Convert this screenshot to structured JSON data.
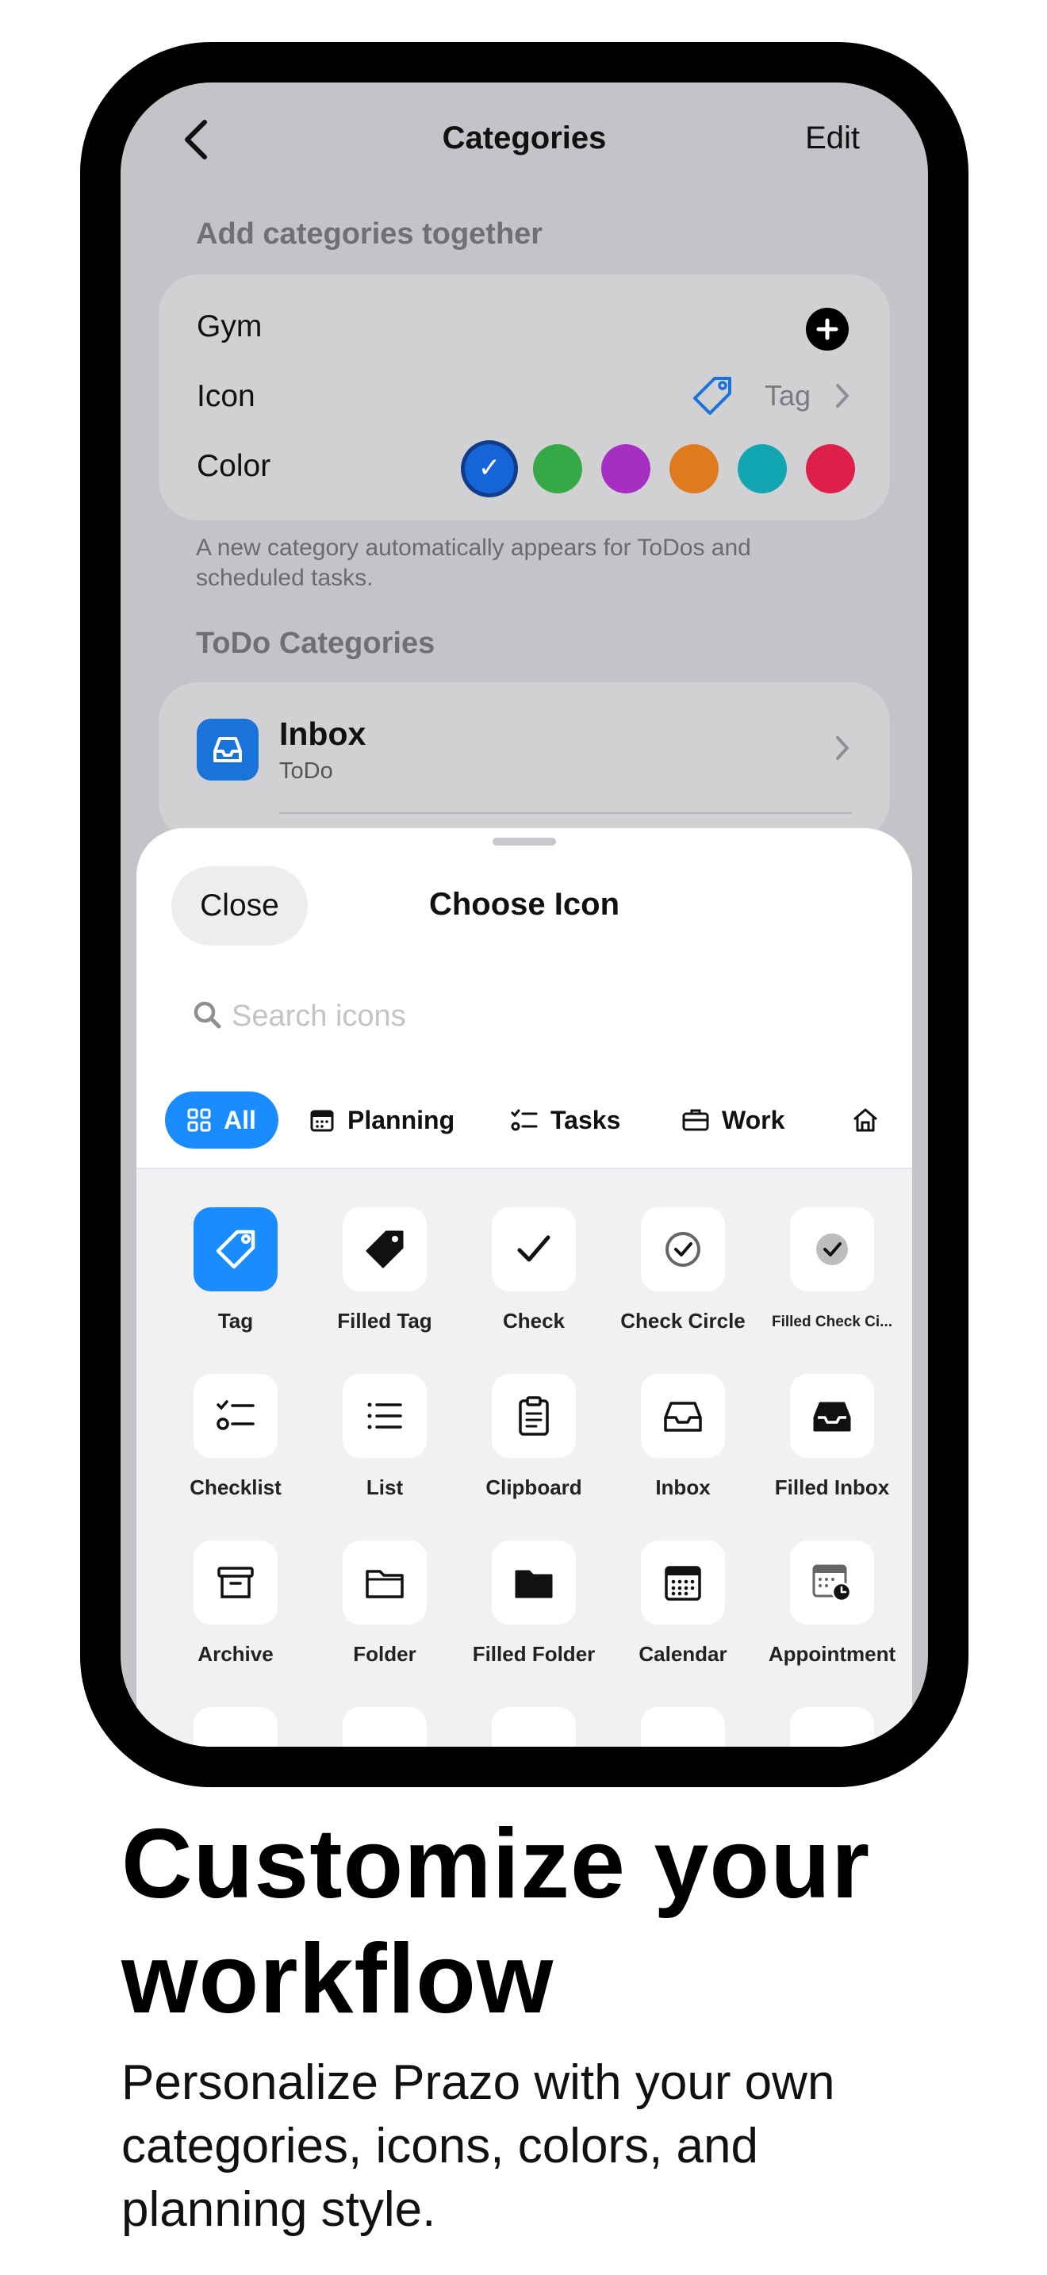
{
  "nav": {
    "title": "Categories",
    "edit_label": "Edit",
    "back_icon": "chevron-left-icon"
  },
  "add_section": {
    "header": "Add categories together",
    "name_value": "Gym",
    "icon_label": "Icon",
    "icon_value": "Tag",
    "color_label": "Color",
    "colors": [
      "#1565d8",
      "#34a946",
      "#a62ec0",
      "#e07a1f",
      "#12a6b3",
      "#dd1f4a"
    ],
    "selected_color_index": 0,
    "footnote": "A new category automatically appears for ToDos and scheduled tasks."
  },
  "todo_section": {
    "header": "ToDo Categories",
    "items": [
      {
        "title": "Inbox",
        "subtitle": "ToDo",
        "color": "#1a73d9"
      }
    ]
  },
  "sheet": {
    "close_label": "Close",
    "title": "Choose Icon",
    "search_placeholder": "Search icons",
    "filters": [
      {
        "label": "All",
        "icon": "grid-icon",
        "active": true
      },
      {
        "label": "Planning",
        "icon": "calendar-icon",
        "active": false
      },
      {
        "label": "Tasks",
        "icon": "checklist-icon",
        "active": false
      },
      {
        "label": "Work",
        "icon": "briefcase-icon",
        "active": false
      },
      {
        "label": "",
        "icon": "home-icon",
        "active": false
      }
    ],
    "icons": [
      {
        "label": "Tag",
        "icon": "tag-icon",
        "selected": true
      },
      {
        "label": "Filled Tag",
        "icon": "filled-tag-icon"
      },
      {
        "label": "Check",
        "icon": "check-icon"
      },
      {
        "label": "Check Circle",
        "icon": "check-circle-icon"
      },
      {
        "label": "Filled Check Ci...",
        "icon": "filled-check-circle-icon"
      },
      {
        "label": "Checklist",
        "icon": "checklist-icon"
      },
      {
        "label": "List",
        "icon": "list-icon"
      },
      {
        "label": "Clipboard",
        "icon": "clipboard-icon"
      },
      {
        "label": "Inbox",
        "icon": "inbox-icon"
      },
      {
        "label": "Filled Inbox",
        "icon": "filled-inbox-icon"
      },
      {
        "label": "Archive",
        "icon": "archive-icon"
      },
      {
        "label": "Folder",
        "icon": "folder-icon"
      },
      {
        "label": "Filled Folder",
        "icon": "filled-folder-icon"
      },
      {
        "label": "Calendar",
        "icon": "calendar-icon"
      },
      {
        "label": "Appointment",
        "icon": "appointment-icon"
      }
    ]
  },
  "marketing": {
    "headline": "Customize your workflow",
    "subline": "Personalize Prazo with your own categories, icons, colors, and planning style."
  }
}
